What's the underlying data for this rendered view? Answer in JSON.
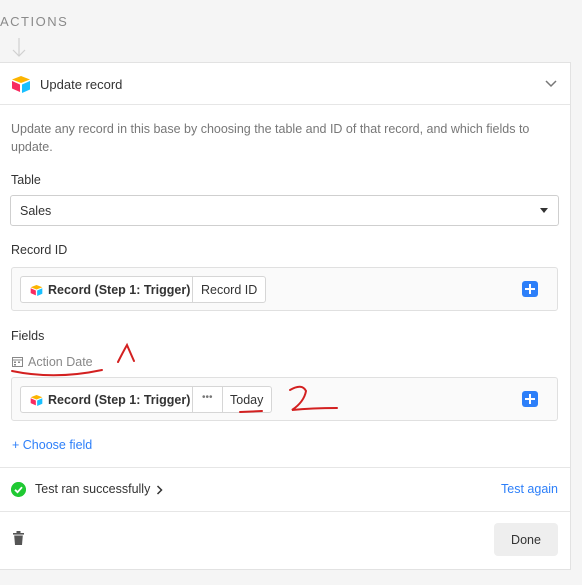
{
  "section": {
    "label": "ACTIONS"
  },
  "step": {
    "title": "Update record",
    "description": "Update any record in this base by choosing the table and ID of that record, and which fields to update."
  },
  "table": {
    "label": "Table",
    "value": "Sales"
  },
  "record_id": {
    "label": "Record ID",
    "token_source": "Record (Step 1: Trigger)",
    "token_field": "Record ID"
  },
  "fields": {
    "label": "Fields",
    "field_name": "Action Date",
    "token_source": "Record (Step 1: Trigger)",
    "token_more": "•••",
    "token_field": "Today"
  },
  "choose_field": "+ Choose field",
  "test": {
    "status": "Test ran successfully",
    "again": "Test again"
  },
  "done_label": "Done",
  "colors": {
    "accent": "#2d7ff9",
    "success": "#20c933",
    "annotation": "#d32020"
  },
  "icons": [
    "flow-arrow-icon",
    "airtable-logo-icon",
    "chevron-down-icon",
    "dropdown-arrow-icon",
    "plus-icon",
    "calendar-icon",
    "check-circle-icon",
    "chevron-right-icon",
    "trash-icon"
  ]
}
